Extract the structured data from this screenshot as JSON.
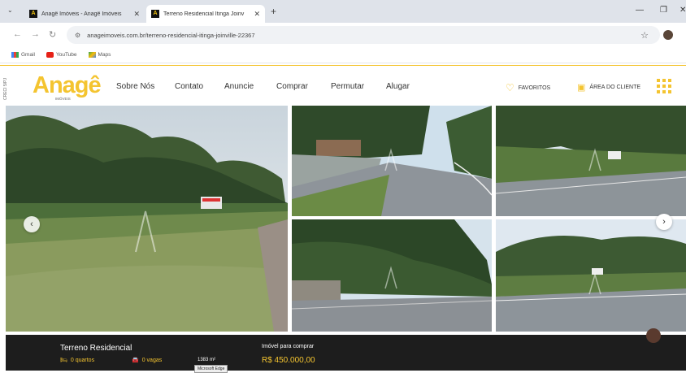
{
  "browser": {
    "tabs": [
      {
        "title": "Anagê Imóveis - Anagê Imóveis",
        "active": false
      },
      {
        "title": "Terreno Residencial Itinga Joinv",
        "active": true
      }
    ],
    "address": "anageimoveis.com.br/terreno-residencial-itinga-joinville-22367",
    "bookmarks": [
      "Gmail",
      "YouTube",
      "Maps"
    ]
  },
  "site": {
    "side_label": "CRECI 5/PJ",
    "logo_text": "Anagê",
    "logo_sub": "IMÓVEIS",
    "menu": [
      "Sobre Nós",
      "Contato",
      "Anuncie",
      "Comprar",
      "Permutar",
      "Alugar"
    ],
    "favorites_label": "FAVORITOS",
    "client_area_label": "ÁREA DO CLIENTE"
  },
  "gallery": {
    "prev_label": "‹",
    "next_label": "›"
  },
  "property": {
    "title": "Terreno Residencial",
    "bedrooms": "0 quartos",
    "parking": "0 vagas",
    "area": "1383 m²",
    "tooltip": "Microsoft Edge",
    "sale_label": "Imóvel para comprar",
    "price": "R$ 450.000,00"
  },
  "colors": {
    "brand": "#f4c430",
    "dark": "#1d1d1d"
  }
}
